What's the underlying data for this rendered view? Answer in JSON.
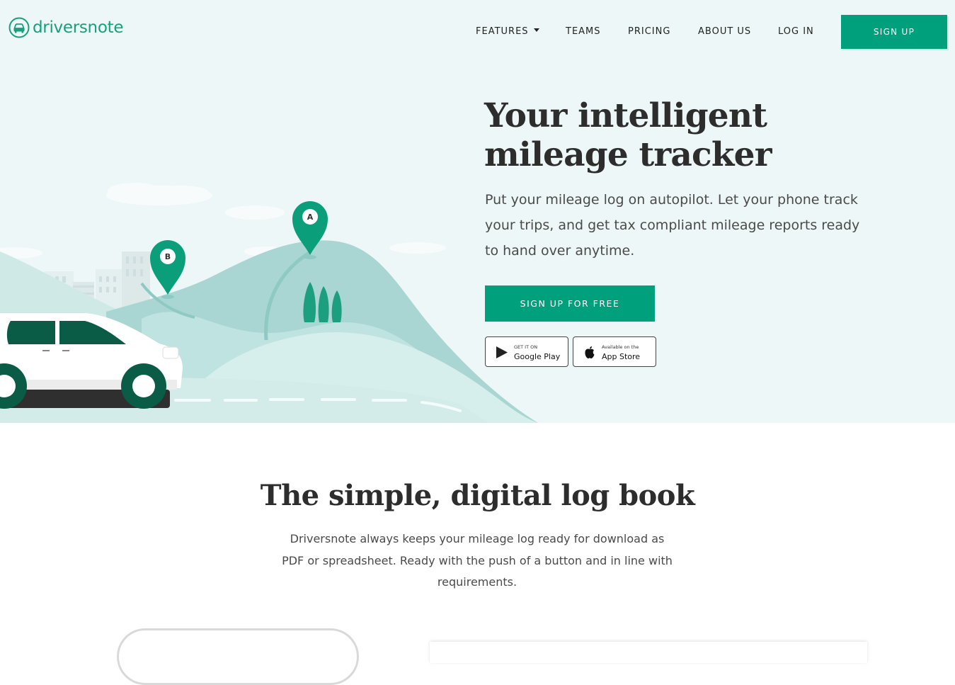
{
  "brand": {
    "name": "driversnote",
    "accent": "#00a07c",
    "logo_icon": "car-icon"
  },
  "nav": {
    "items": [
      {
        "label": "FEATURES",
        "has_dropdown": true
      },
      {
        "label": "TEAMS"
      },
      {
        "label": "PRICING"
      },
      {
        "label": "ABOUT US"
      },
      {
        "label": "LOG IN"
      }
    ],
    "signup_label": "SIGN UP"
  },
  "hero": {
    "title_line1": "Your intelligent",
    "title_line2": "mileage tracker",
    "subtitle": "Put your mileage log on autopilot. Let your phone track your trips, and get tax compliant mileage reports ready to hand over anytime.",
    "cta_label": "SIGN UP FOR FREE",
    "background": "#eef7f7",
    "stores": {
      "google": {
        "small": "GET IT ON",
        "big": "Google Play",
        "icon": "google-play-icon"
      },
      "apple": {
        "small": "Available on the",
        "big": "App Store",
        "icon": "apple-icon"
      }
    },
    "pins": {
      "a": "A",
      "b": "B"
    }
  },
  "section": {
    "title": "The simple, digital log book",
    "text": "Driversnote always keeps your mileage log ready for download as PDF or spreadsheet. Ready with the push of a button and in line with requirements."
  }
}
